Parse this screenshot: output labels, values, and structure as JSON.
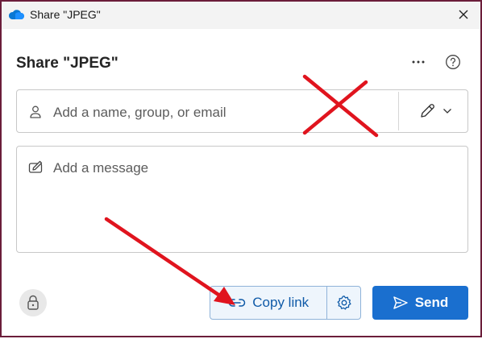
{
  "window": {
    "title": "Share \"JPEG\"",
    "app_icon": "onedrive-cloud-icon",
    "close_icon": "close-icon"
  },
  "dialog": {
    "title": "Share \"JPEG\"",
    "more_icon": "more-icon",
    "help_icon": "help-icon"
  },
  "recipient": {
    "placeholder": "Add a name, group, or email",
    "person_icon": "person-icon",
    "permission_icon": "pencil-icon"
  },
  "message": {
    "placeholder": "Add a message",
    "icon": "compose-icon"
  },
  "footer": {
    "lock_icon": "lock-icon",
    "copy_link_label": "Copy link",
    "settings_icon": "gear-icon",
    "send_label": "Send"
  },
  "colors": {
    "accent": "#1a6fcf",
    "link_text": "#0f5aa8",
    "annotation": "#e0141e",
    "window_border": "#6b1d3a"
  }
}
